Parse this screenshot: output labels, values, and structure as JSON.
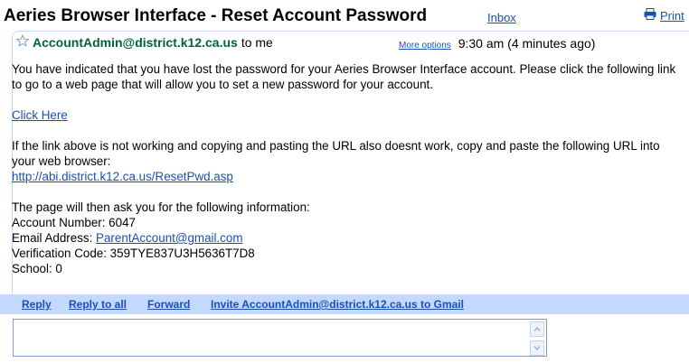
{
  "email": {
    "subject": "Aeries Browser Interface - Reset Account Password",
    "label": "Inbox",
    "print": "Print",
    "sender": "AccountAdmin@district.k12.ca.us",
    "to": "to me",
    "more_options": "More options",
    "time": "9:30 am (4 minutes ago)",
    "intro": "You have indicated that you have lost the password for your Aeries Browser Interface account. Please click the following link to go to a web page that will allow you to set a new password for your account.",
    "click_here": "Click Here",
    "fallback_text": "If the link above is not working and copying and pasting the URL also doesnt work, copy and paste the following URL into your web browser:",
    "url": "http://abi.district.k12.ca.us/ResetPwd.asp",
    "info_intro": "The page will then ask you for the following information:",
    "account_number": "Account Number: 6047",
    "email_label": "Email Address: ",
    "email_value": "ParentAccount@gmail.com",
    "verification": "Verification Code: 359TYE837U3H5636T7D8",
    "school": "School: 0"
  },
  "actions": {
    "reply": "Reply",
    "reply_all": "Reply to all",
    "forward": "Forward",
    "invite": "Invite AccountAdmin@district.k12.ca.us to Gmail"
  },
  "colors": {
    "link": "#1a4fb4",
    "sender": "#006633",
    "action_bar": "#c3d9ff"
  }
}
